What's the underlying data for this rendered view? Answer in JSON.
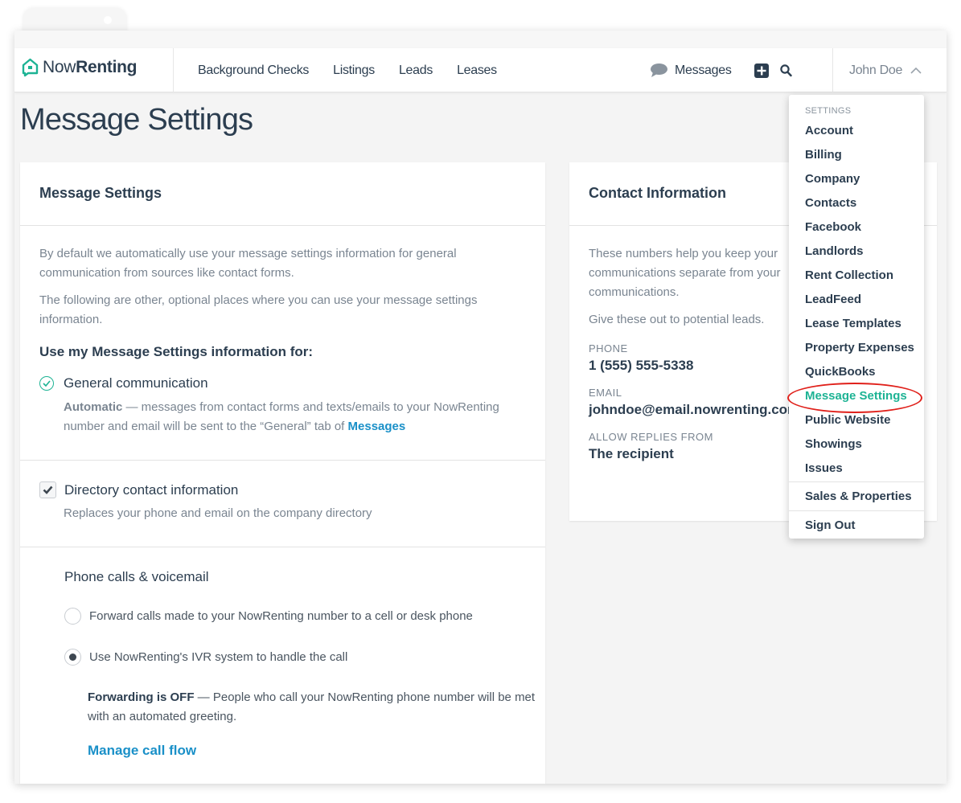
{
  "brand": {
    "name_light": "Now",
    "name_bold": "Renting",
    "accent": "#1db394",
    "link_color": "#1a90c8"
  },
  "nav": {
    "links": [
      "Background Checks",
      "Listings",
      "Leads",
      "Leases"
    ],
    "messages_label": "Messages",
    "user_name": "John Doe"
  },
  "page": {
    "title": "Message Settings"
  },
  "message_settings_card": {
    "title": "Message Settings",
    "intro_1": "By default we automatically use your message settings information for general communication from sources like contact forms.",
    "intro_2": "The following are other, optional places where you can use your message settings information.",
    "use_for_heading": "Use my Message Settings information for:",
    "general": {
      "label": "General communication",
      "desc_bold": "Automatic",
      "desc": " — messages from contact forms and texts/emails to your NowRenting number and email will be sent to the “General” tab of ",
      "desc_link": "Messages"
    },
    "directory": {
      "label": "Directory contact information",
      "checked": true,
      "desc": "Replaces your phone and email on the company directory"
    },
    "phone": {
      "title": "Phone calls & voicemail",
      "options": [
        {
          "label": "Forward calls made to your NowRenting number to a cell or desk phone",
          "selected": false
        },
        {
          "label": "Use NowRenting's IVR system to handle the call",
          "selected": true
        }
      ],
      "forwarding_bold": "Forwarding is OFF",
      "forwarding_desc": " — People who call your NowRenting phone number will be met with an automated greeting.",
      "manage_link": "Manage call flow"
    }
  },
  "contact_card": {
    "title": "Contact Information",
    "intro_1": "These numbers help you keep your communications separate from your communications.",
    "intro_1_lines": [
      "These numbers help you keep your",
      "communications separate from your",
      "communications."
    ],
    "intro_2": "Give these out to potential leads.",
    "phone_label": "PHONE",
    "phone_value": "1 (555) 555-5338",
    "email_label": "EMAIL",
    "email_value": "johndoe@email.nowrenting.com",
    "replies_label": "ALLOW REPLIES FROM",
    "replies_value": "The recipient"
  },
  "dropdown": {
    "header": "SETTINGS",
    "items": [
      "Account",
      "Billing",
      "Company",
      "Contacts",
      "Facebook",
      "Landlords",
      "Rent Collection",
      "LeadFeed",
      "Lease Templates",
      "Property Expenses",
      "QuickBooks",
      "Message Settings",
      "Public Website",
      "Showings",
      "Issues"
    ],
    "active_item": "Message Settings",
    "sales": "Sales & Properties",
    "signout": "Sign Out"
  }
}
